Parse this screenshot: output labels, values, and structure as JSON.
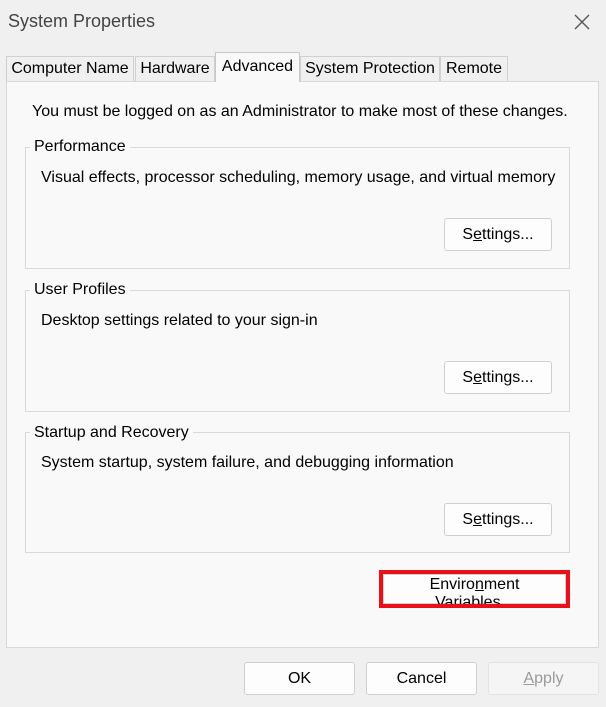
{
  "window": {
    "title": "System Properties"
  },
  "tabs": [
    {
      "label": "Computer Name"
    },
    {
      "label": "Hardware"
    },
    {
      "label": "Advanced"
    },
    {
      "label": "System Protection"
    },
    {
      "label": "Remote"
    }
  ],
  "active_tab": "Advanced",
  "admin_note": "You must be logged on as an Administrator to make most of these changes.",
  "groups": {
    "performance": {
      "legend": "Performance",
      "description": "Visual effects, processor scheduling, memory usage, and virtual memory",
      "button": {
        "pre": "S",
        "u": "e",
        "post": "ttings..."
      }
    },
    "user_profiles": {
      "legend": "User Profiles",
      "description": "Desktop settings related to your sign-in",
      "button": {
        "pre": "S",
        "u": "e",
        "post": "ttings..."
      }
    },
    "startup_recovery": {
      "legend": "Startup and Recovery",
      "description": "System startup, system failure, and debugging information",
      "button": {
        "pre": "S",
        "u": "e",
        "post": "ttings..."
      }
    }
  },
  "env_button": {
    "pre": "Enviro",
    "u": "n",
    "post": "ment Variables..."
  },
  "footer": {
    "ok": "OK",
    "cancel": "Cancel",
    "apply_u": "A",
    "apply_post": "pply"
  },
  "colors": {
    "highlight": "#e8101a",
    "background": "#f0f0f0",
    "panel": "#f9f9f9"
  }
}
